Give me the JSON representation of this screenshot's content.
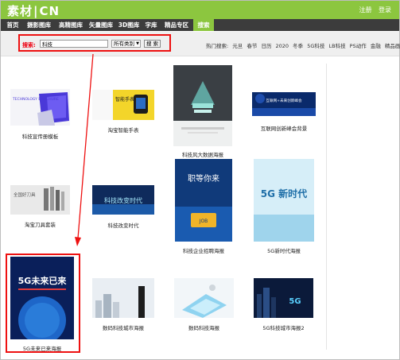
{
  "header": {
    "logo_part1": "素材",
    "logo_part2": "CN",
    "links": [
      "注册",
      "登录"
    ]
  },
  "nav": {
    "items": [
      "首页",
      "摄影图库",
      "高精图库",
      "矢量图库",
      "3D图库",
      "字库",
      "精品专区",
      "搜索"
    ]
  },
  "search": {
    "label": "搜索:",
    "value": "科技",
    "category": "所有类别",
    "button": "搜 索"
  },
  "hot": {
    "label": "热门搜索:",
    "terms": [
      "元旦",
      "春节",
      "日历",
      "2020",
      "冬季",
      "5G科技",
      "LB科技",
      "PS动作",
      "金融",
      "精品画册"
    ]
  },
  "results": [
    {
      "caption": "科技宣传册模板",
      "thumb_text": "TECHNOLOGY BROCHURE"
    },
    {
      "caption": "淘宝智能手表",
      "thumb_text": "智能手表"
    },
    {
      "caption": "科技风大数据海报",
      "thumb_text": ""
    },
    {
      "caption": "互联网创新峰会背景",
      "thumb_text": "互联网+未来创新峰会"
    },
    {
      "caption": "淘宝刀具套装",
      "thumb_text": "全国好刀具"
    },
    {
      "caption": "科技改变时代",
      "thumb_text": "科技改变时代"
    },
    {
      "caption": "科技企业招聘海报",
      "thumb_text": "职等你来"
    },
    {
      "caption": "5G新时代海报",
      "thumb_text": "5G 新时代"
    },
    {
      "caption": "5G未来已来海报",
      "thumb_text": "5G未来已来"
    },
    {
      "caption": "数码科技城市海报",
      "thumb_text": ""
    },
    {
      "caption": "数码科技海报",
      "thumb_text": ""
    },
    {
      "caption": "5G科技城市海报2",
      "thumb_text": "5G"
    }
  ],
  "colors": {
    "brand_green": "#8cc63f",
    "nav_dark": "#3c3c3c",
    "highlight_red": "#e11111"
  }
}
